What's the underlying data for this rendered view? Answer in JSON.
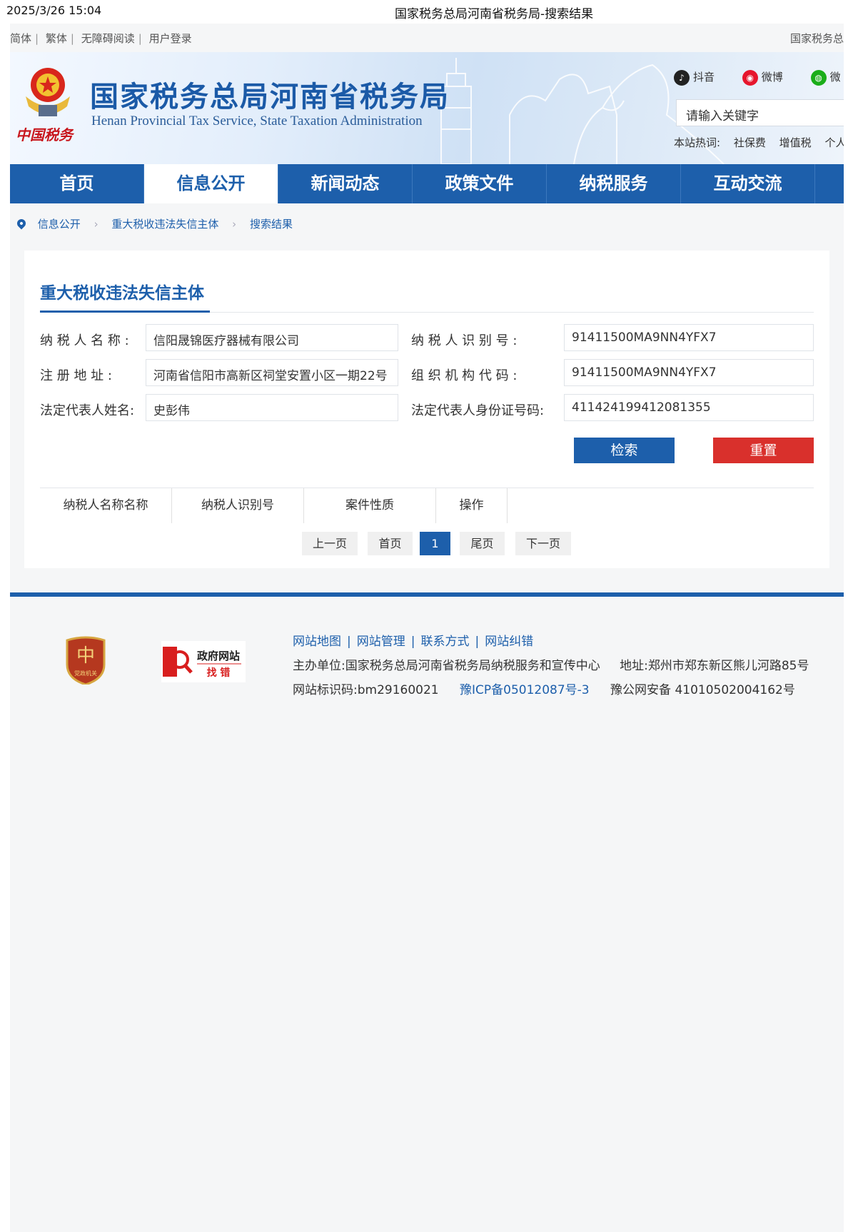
{
  "print_header": {
    "timestamp": "2025/3/26 15:04",
    "title": "国家税务总局河南省税务局-搜索结果"
  },
  "topbar": {
    "links": [
      "简体",
      "繁体",
      "无障碍阅读",
      "用户登录"
    ],
    "right_text": "国家税务总"
  },
  "banner": {
    "emblem_text": "中国税务",
    "title": "国家税务总局河南省税务局",
    "subtitle": "Henan Provincial Tax Service, State Taxation Administration",
    "social": [
      {
        "label": "抖音",
        "icon": "douyin-icon",
        "color": "#222222"
      },
      {
        "label": "微博",
        "icon": "weibo-icon",
        "color": "#e6162d"
      },
      {
        "label": "微",
        "icon": "wechat-icon",
        "color": "#1aad19"
      }
    ],
    "search_placeholder": "请输入关键字",
    "hotwords_label": "本站热词:",
    "hotwords": [
      "社保费",
      "增值税",
      "个人"
    ]
  },
  "nav": {
    "items": [
      "首页",
      "信息公开",
      "新闻动态",
      "政策文件",
      "纳税服务",
      "互动交流"
    ],
    "active_index": 1
  },
  "breadcrumb": [
    "信息公开",
    "重大税收违法失信主体",
    "搜索结果"
  ],
  "form": {
    "title": "重大税收违法失信主体",
    "taxpayer_name_label": "纳 税 人 名 称 :",
    "taxpayer_name_value": "信阳晟锦医疗器械有限公司",
    "taxpayer_id_label": "纳 税 人 识 别 号 :",
    "taxpayer_id_value": "91411500MA9NN4YFX7",
    "address_label": "注 册 地 址 :",
    "address_value": "河南省信阳市高新区祠堂安置小区一期22号",
    "org_code_label": "组 织 机 构 代 码 :",
    "org_code_value": "91411500MA9NN4YFX7",
    "legal_rep_label": "法定代表人姓名:",
    "legal_rep_value": "史彭伟",
    "legal_rep_id_label": "法定代表人身份证号码:",
    "legal_rep_id_value": "411424199412081355",
    "search_button": "检索",
    "reset_button": "重置"
  },
  "table": {
    "headers": [
      "纳税人名称名称",
      "纳税人识别号",
      "案件性质",
      "操作"
    ]
  },
  "pagination": {
    "prev": "上一页",
    "first": "首页",
    "current": "1",
    "last": "尾页",
    "next": "下一页"
  },
  "footer": {
    "links": [
      "网站地图",
      "网站管理",
      "联系方式",
      "网站纠错"
    ],
    "sponsor": "主办单位:国家税务总局河南省税务局纳税服务和宣传中心",
    "address": "地址:郑州市郑东新区熊儿河路85号",
    "site_id": "网站标识码:bm29160021",
    "icp": "豫ICP备05012087号-3",
    "police": "豫公网安备 41010502004162号",
    "badge1_text": "党政机关",
    "badge2_line1": "政府网站",
    "badge2_line2": "找 错"
  },
  "colors": {
    "primary": "#1d5fab",
    "danger": "#d9302c"
  }
}
